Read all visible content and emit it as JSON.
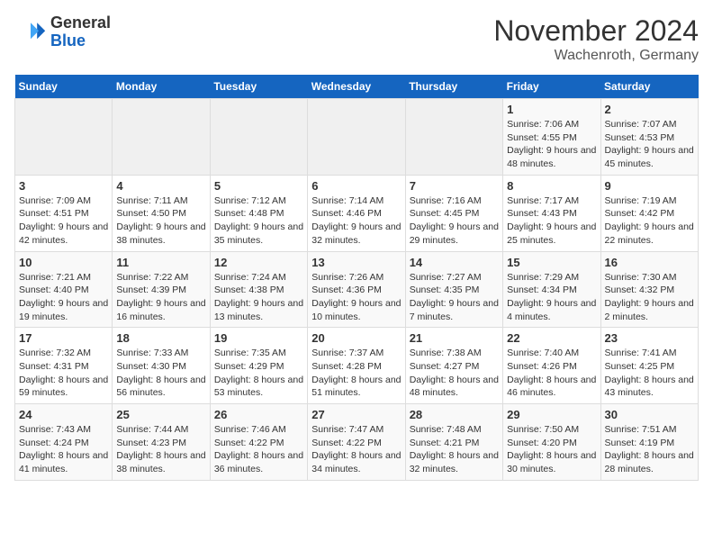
{
  "header": {
    "logo_general": "General",
    "logo_blue": "Blue",
    "month_title": "November 2024",
    "location": "Wachenroth, Germany"
  },
  "weekdays": [
    "Sunday",
    "Monday",
    "Tuesday",
    "Wednesday",
    "Thursday",
    "Friday",
    "Saturday"
  ],
  "weeks": [
    [
      {
        "day": "",
        "info": ""
      },
      {
        "day": "",
        "info": ""
      },
      {
        "day": "",
        "info": ""
      },
      {
        "day": "",
        "info": ""
      },
      {
        "day": "",
        "info": ""
      },
      {
        "day": "1",
        "info": "Sunrise: 7:06 AM\nSunset: 4:55 PM\nDaylight: 9 hours and 48 minutes."
      },
      {
        "day": "2",
        "info": "Sunrise: 7:07 AM\nSunset: 4:53 PM\nDaylight: 9 hours and 45 minutes."
      }
    ],
    [
      {
        "day": "3",
        "info": "Sunrise: 7:09 AM\nSunset: 4:51 PM\nDaylight: 9 hours and 42 minutes."
      },
      {
        "day": "4",
        "info": "Sunrise: 7:11 AM\nSunset: 4:50 PM\nDaylight: 9 hours and 38 minutes."
      },
      {
        "day": "5",
        "info": "Sunrise: 7:12 AM\nSunset: 4:48 PM\nDaylight: 9 hours and 35 minutes."
      },
      {
        "day": "6",
        "info": "Sunrise: 7:14 AM\nSunset: 4:46 PM\nDaylight: 9 hours and 32 minutes."
      },
      {
        "day": "7",
        "info": "Sunrise: 7:16 AM\nSunset: 4:45 PM\nDaylight: 9 hours and 29 minutes."
      },
      {
        "day": "8",
        "info": "Sunrise: 7:17 AM\nSunset: 4:43 PM\nDaylight: 9 hours and 25 minutes."
      },
      {
        "day": "9",
        "info": "Sunrise: 7:19 AM\nSunset: 4:42 PM\nDaylight: 9 hours and 22 minutes."
      }
    ],
    [
      {
        "day": "10",
        "info": "Sunrise: 7:21 AM\nSunset: 4:40 PM\nDaylight: 9 hours and 19 minutes."
      },
      {
        "day": "11",
        "info": "Sunrise: 7:22 AM\nSunset: 4:39 PM\nDaylight: 9 hours and 16 minutes."
      },
      {
        "day": "12",
        "info": "Sunrise: 7:24 AM\nSunset: 4:38 PM\nDaylight: 9 hours and 13 minutes."
      },
      {
        "day": "13",
        "info": "Sunrise: 7:26 AM\nSunset: 4:36 PM\nDaylight: 9 hours and 10 minutes."
      },
      {
        "day": "14",
        "info": "Sunrise: 7:27 AM\nSunset: 4:35 PM\nDaylight: 9 hours and 7 minutes."
      },
      {
        "day": "15",
        "info": "Sunrise: 7:29 AM\nSunset: 4:34 PM\nDaylight: 9 hours and 4 minutes."
      },
      {
        "day": "16",
        "info": "Sunrise: 7:30 AM\nSunset: 4:32 PM\nDaylight: 9 hours and 2 minutes."
      }
    ],
    [
      {
        "day": "17",
        "info": "Sunrise: 7:32 AM\nSunset: 4:31 PM\nDaylight: 8 hours and 59 minutes."
      },
      {
        "day": "18",
        "info": "Sunrise: 7:33 AM\nSunset: 4:30 PM\nDaylight: 8 hours and 56 minutes."
      },
      {
        "day": "19",
        "info": "Sunrise: 7:35 AM\nSunset: 4:29 PM\nDaylight: 8 hours and 53 minutes."
      },
      {
        "day": "20",
        "info": "Sunrise: 7:37 AM\nSunset: 4:28 PM\nDaylight: 8 hours and 51 minutes."
      },
      {
        "day": "21",
        "info": "Sunrise: 7:38 AM\nSunset: 4:27 PM\nDaylight: 8 hours and 48 minutes."
      },
      {
        "day": "22",
        "info": "Sunrise: 7:40 AM\nSunset: 4:26 PM\nDaylight: 8 hours and 46 minutes."
      },
      {
        "day": "23",
        "info": "Sunrise: 7:41 AM\nSunset: 4:25 PM\nDaylight: 8 hours and 43 minutes."
      }
    ],
    [
      {
        "day": "24",
        "info": "Sunrise: 7:43 AM\nSunset: 4:24 PM\nDaylight: 8 hours and 41 minutes."
      },
      {
        "day": "25",
        "info": "Sunrise: 7:44 AM\nSunset: 4:23 PM\nDaylight: 8 hours and 38 minutes."
      },
      {
        "day": "26",
        "info": "Sunrise: 7:46 AM\nSunset: 4:22 PM\nDaylight: 8 hours and 36 minutes."
      },
      {
        "day": "27",
        "info": "Sunrise: 7:47 AM\nSunset: 4:22 PM\nDaylight: 8 hours and 34 minutes."
      },
      {
        "day": "28",
        "info": "Sunrise: 7:48 AM\nSunset: 4:21 PM\nDaylight: 8 hours and 32 minutes."
      },
      {
        "day": "29",
        "info": "Sunrise: 7:50 AM\nSunset: 4:20 PM\nDaylight: 8 hours and 30 minutes."
      },
      {
        "day": "30",
        "info": "Sunrise: 7:51 AM\nSunset: 4:19 PM\nDaylight: 8 hours and 28 minutes."
      }
    ]
  ]
}
